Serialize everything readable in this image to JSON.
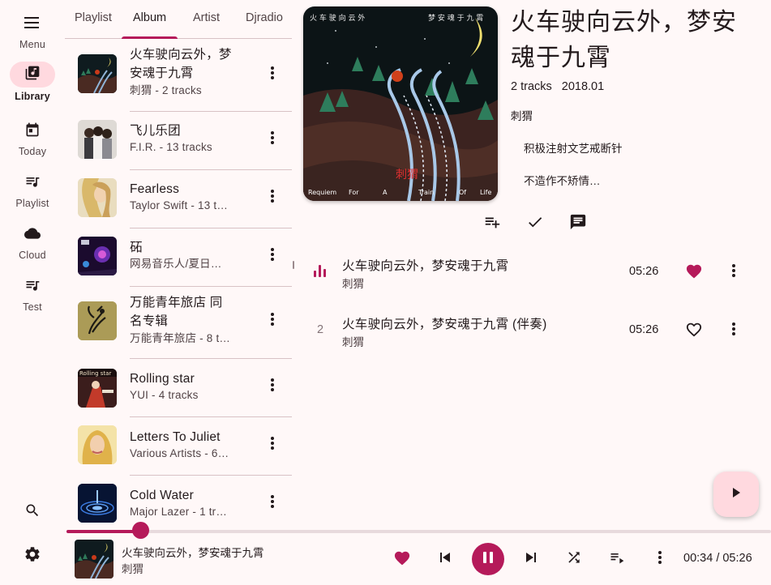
{
  "colors": {
    "accent": "#b51a5a",
    "accent_container": "#ffd9df",
    "background": "#fff8f8"
  },
  "nav": {
    "menu_label": "Menu",
    "items": [
      {
        "label": "Library",
        "icon": "library-music-icon",
        "active": true
      },
      {
        "label": "Today",
        "icon": "calendar-icon"
      },
      {
        "label": "Playlist",
        "icon": "playlist-icon"
      },
      {
        "label": "Cloud",
        "icon": "cloud-icon"
      },
      {
        "label": "Test",
        "icon": "playlist-icon"
      }
    ],
    "bottom": [
      "search-icon",
      "settings-icon"
    ]
  },
  "tabs": [
    "Playlist",
    "Album",
    "Artist",
    "Djradio"
  ],
  "active_tab": "Album",
  "albums": [
    {
      "title": "火车驶向云外，梦安魂于九霄",
      "title_lines": [
        "火车驶向云外，梦",
        "安魂于九霄"
      ],
      "subtitle": "刺猬 - 2 tracks"
    },
    {
      "title": "飞儿乐团",
      "title_lines": [
        "飞儿乐团"
      ],
      "subtitle": "F.I.R. - 13 tracks"
    },
    {
      "title": "Fearless",
      "title_lines": [
        "Fearless"
      ],
      "subtitle": "Taylor Swift - 13 t…"
    },
    {
      "title": "砳",
      "title_lines": [
        "砳"
      ],
      "subtitle": "网易音乐人/夏日…"
    },
    {
      "title": "万能青年旅店 同名专辑",
      "title_lines": [
        "万能青年旅店 同",
        "名专辑"
      ],
      "subtitle": "万能青年旅店 - 8 t…"
    },
    {
      "title": "Rolling star",
      "title_lines": [
        "Rolling star"
      ],
      "subtitle": "YUI - 4 tracks"
    },
    {
      "title": "Letters To Juliet",
      "title_lines": [
        "Letters To Juliet"
      ],
      "subtitle": "Various Artists - 6…"
    },
    {
      "title": "Cold Water",
      "title_lines": [
        "Cold Water"
      ],
      "subtitle": "Major Lazer - 1 tr…"
    }
  ],
  "detail": {
    "title": "火车驶向云外，梦安魂于九霄",
    "title_lines": [
      "火车驶向云外，梦安",
      "魂于九霄"
    ],
    "track_count": "2 tracks",
    "year": "2018.01",
    "artist": "刺猬",
    "descriptions": [
      "积极注射文艺戒断针",
      "不造作不矫情…"
    ],
    "cover_text": {
      "top_left": "火 车 驶 向 云 外",
      "top_right": "梦 安 魂 于 九 霄",
      "bottom": [
        "Requiem",
        "For",
        "A",
        "Train",
        "Of",
        "Life"
      ],
      "seal": "刺猬"
    },
    "actions": [
      "playlist-add-icon",
      "check-icon",
      "comment-icon"
    ]
  },
  "tracks": [
    {
      "index": "",
      "playing": true,
      "title": "火车驶向云外，梦安魂于九霄",
      "artist": "刺猬",
      "duration": "05:26",
      "liked": true
    },
    {
      "index": "2",
      "playing": false,
      "title": "火车驶向云外，梦安魂于九霄 (伴奏)",
      "artist": "刺猬",
      "duration": "05:26",
      "liked": false
    }
  ],
  "player": {
    "title": "火车驶向云外，梦安魂于九霄",
    "artist": "刺猬",
    "time_display": "00:34 / 05:26",
    "progress_fraction": 0.105,
    "liked": true,
    "is_playing": true
  }
}
